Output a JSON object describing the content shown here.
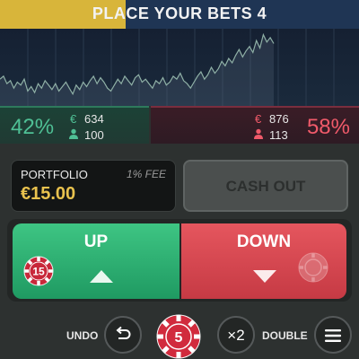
{
  "header": {
    "title": "PLACE YOUR BETS 4",
    "timer_progress": 0.35,
    "progress_color": "#d8b53a"
  },
  "chart": {
    "series": [
      58,
      60,
      55,
      57,
      52,
      56,
      54,
      58,
      50,
      53,
      49,
      55,
      52,
      57,
      54,
      51,
      55,
      50,
      53,
      56,
      52,
      48,
      54,
      51,
      56,
      53,
      57,
      60,
      55,
      59,
      56,
      52,
      50,
      54,
      58,
      55,
      60,
      57,
      54,
      59,
      61,
      56,
      58,
      55,
      52,
      57,
      55,
      59,
      54,
      56,
      60,
      58,
      62,
      57,
      55,
      52,
      56,
      60,
      63,
      58,
      61,
      66,
      62,
      65,
      70,
      67,
      72,
      69,
      74,
      78,
      73,
      77,
      80,
      76,
      84,
      79,
      88,
      83,
      86,
      82
    ]
  },
  "pager": {
    "count": 4,
    "active": 0
  },
  "stats": {
    "up": {
      "percent": "42%",
      "currency": "€",
      "amount": "634",
      "players": "100",
      "user_icon": "person-icon"
    },
    "down": {
      "percent": "58%",
      "currency": "€",
      "amount": "876",
      "players": "113",
      "user_icon": "person-icon"
    }
  },
  "portfolio": {
    "label": "PORTFOLIO",
    "fee": "1% FEE",
    "value": "€15.00"
  },
  "cashout": {
    "label": "CASH OUT"
  },
  "bets": {
    "up": {
      "label": "UP",
      "chip_value": "15",
      "icon": "arrow-up-icon"
    },
    "down": {
      "label": "DOWN",
      "icon": "arrow-down-icon"
    }
  },
  "controls": {
    "undo_label": "UNDO",
    "chip_value": "5",
    "double_multiplier": "×2",
    "double_label": "DOUBLE"
  },
  "colors": {
    "up": "#3ec583",
    "down": "#e5565e",
    "accent": "#e9c24e"
  }
}
